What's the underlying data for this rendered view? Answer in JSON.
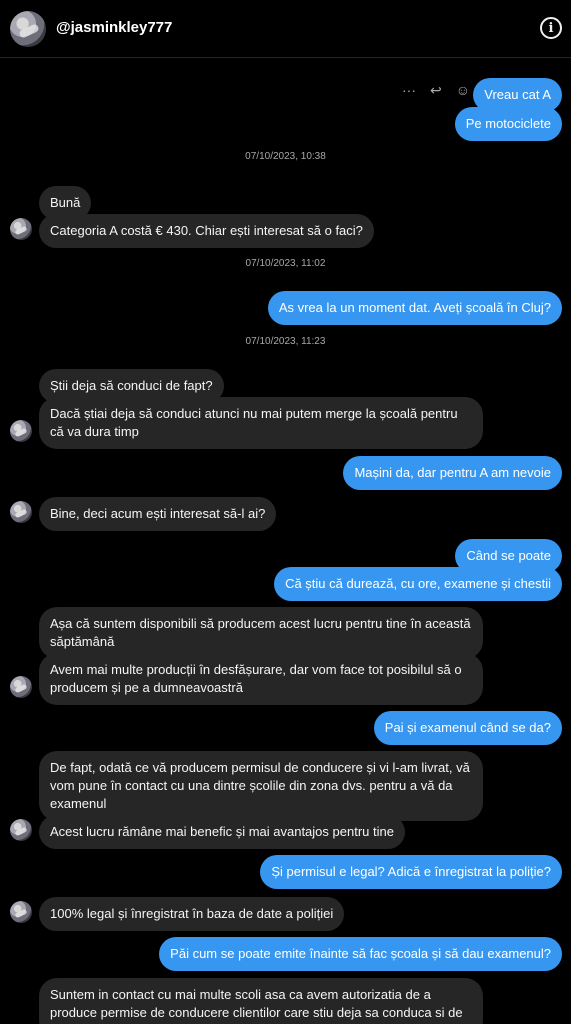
{
  "header": {
    "username": "@jasminkley777",
    "info_icon": "info-circle-icon"
  },
  "message_actions": {
    "more_icon": "···",
    "reply_icon": "↩",
    "react_icon": "☺"
  },
  "messages": {
    "m1": "Vreau cat A",
    "m2": "Pe motociclete",
    "ts1": "07/10/2023, 10:38",
    "m3": "Bună",
    "m4": "Categoria A costă € 430. Chiar ești interesat să o faci?",
    "ts2": "07/10/2023, 11:02",
    "m5": "As vrea la un moment dat. Aveți școală în Cluj?",
    "ts3": "07/10/2023, 11:23",
    "m6": "Știi deja să conduci de fapt?",
    "m7": "Dacă știai deja să conduci atunci nu mai putem merge la școală pentru că va dura timp",
    "m8": "Mașini da, dar pentru A am nevoie",
    "m9": "Bine, deci acum ești interesat să-l ai?",
    "m10": "Când se poate",
    "m11": "Că știu că durează, cu ore, examene și chestii",
    "m12": "Așa că suntem disponibili să producem acest lucru pentru tine în această săptămână",
    "m13": "Avem mai multe producții în desfășurare, dar vom face tot posibilul să o producem și pe a dumneavoastră",
    "m14": "Pai și examenul când se da?",
    "m15": "De fapt, odată ce vă producem permisul de conducere și vi l-am livrat, vă vom pune în contact cu una dintre școlile din zona dvs. pentru a vă da examenul",
    "m16": "Acest lucru rămâne mai benefic și mai avantajos pentru tine",
    "m17": "Și permisul e legal? Adică e înregistrat la poliție?",
    "m18": "100% legal și înregistrat în baza de date a poliției",
    "m19": "Păi cum se poate emite înainte să fac școala și să dau examenul?",
    "m20": "Suntem in contact cu mai multe scoli asa ca avem autorizatia de a produce permise de conducere clientilor care stiu deja sa conduca si de a le livra"
  }
}
